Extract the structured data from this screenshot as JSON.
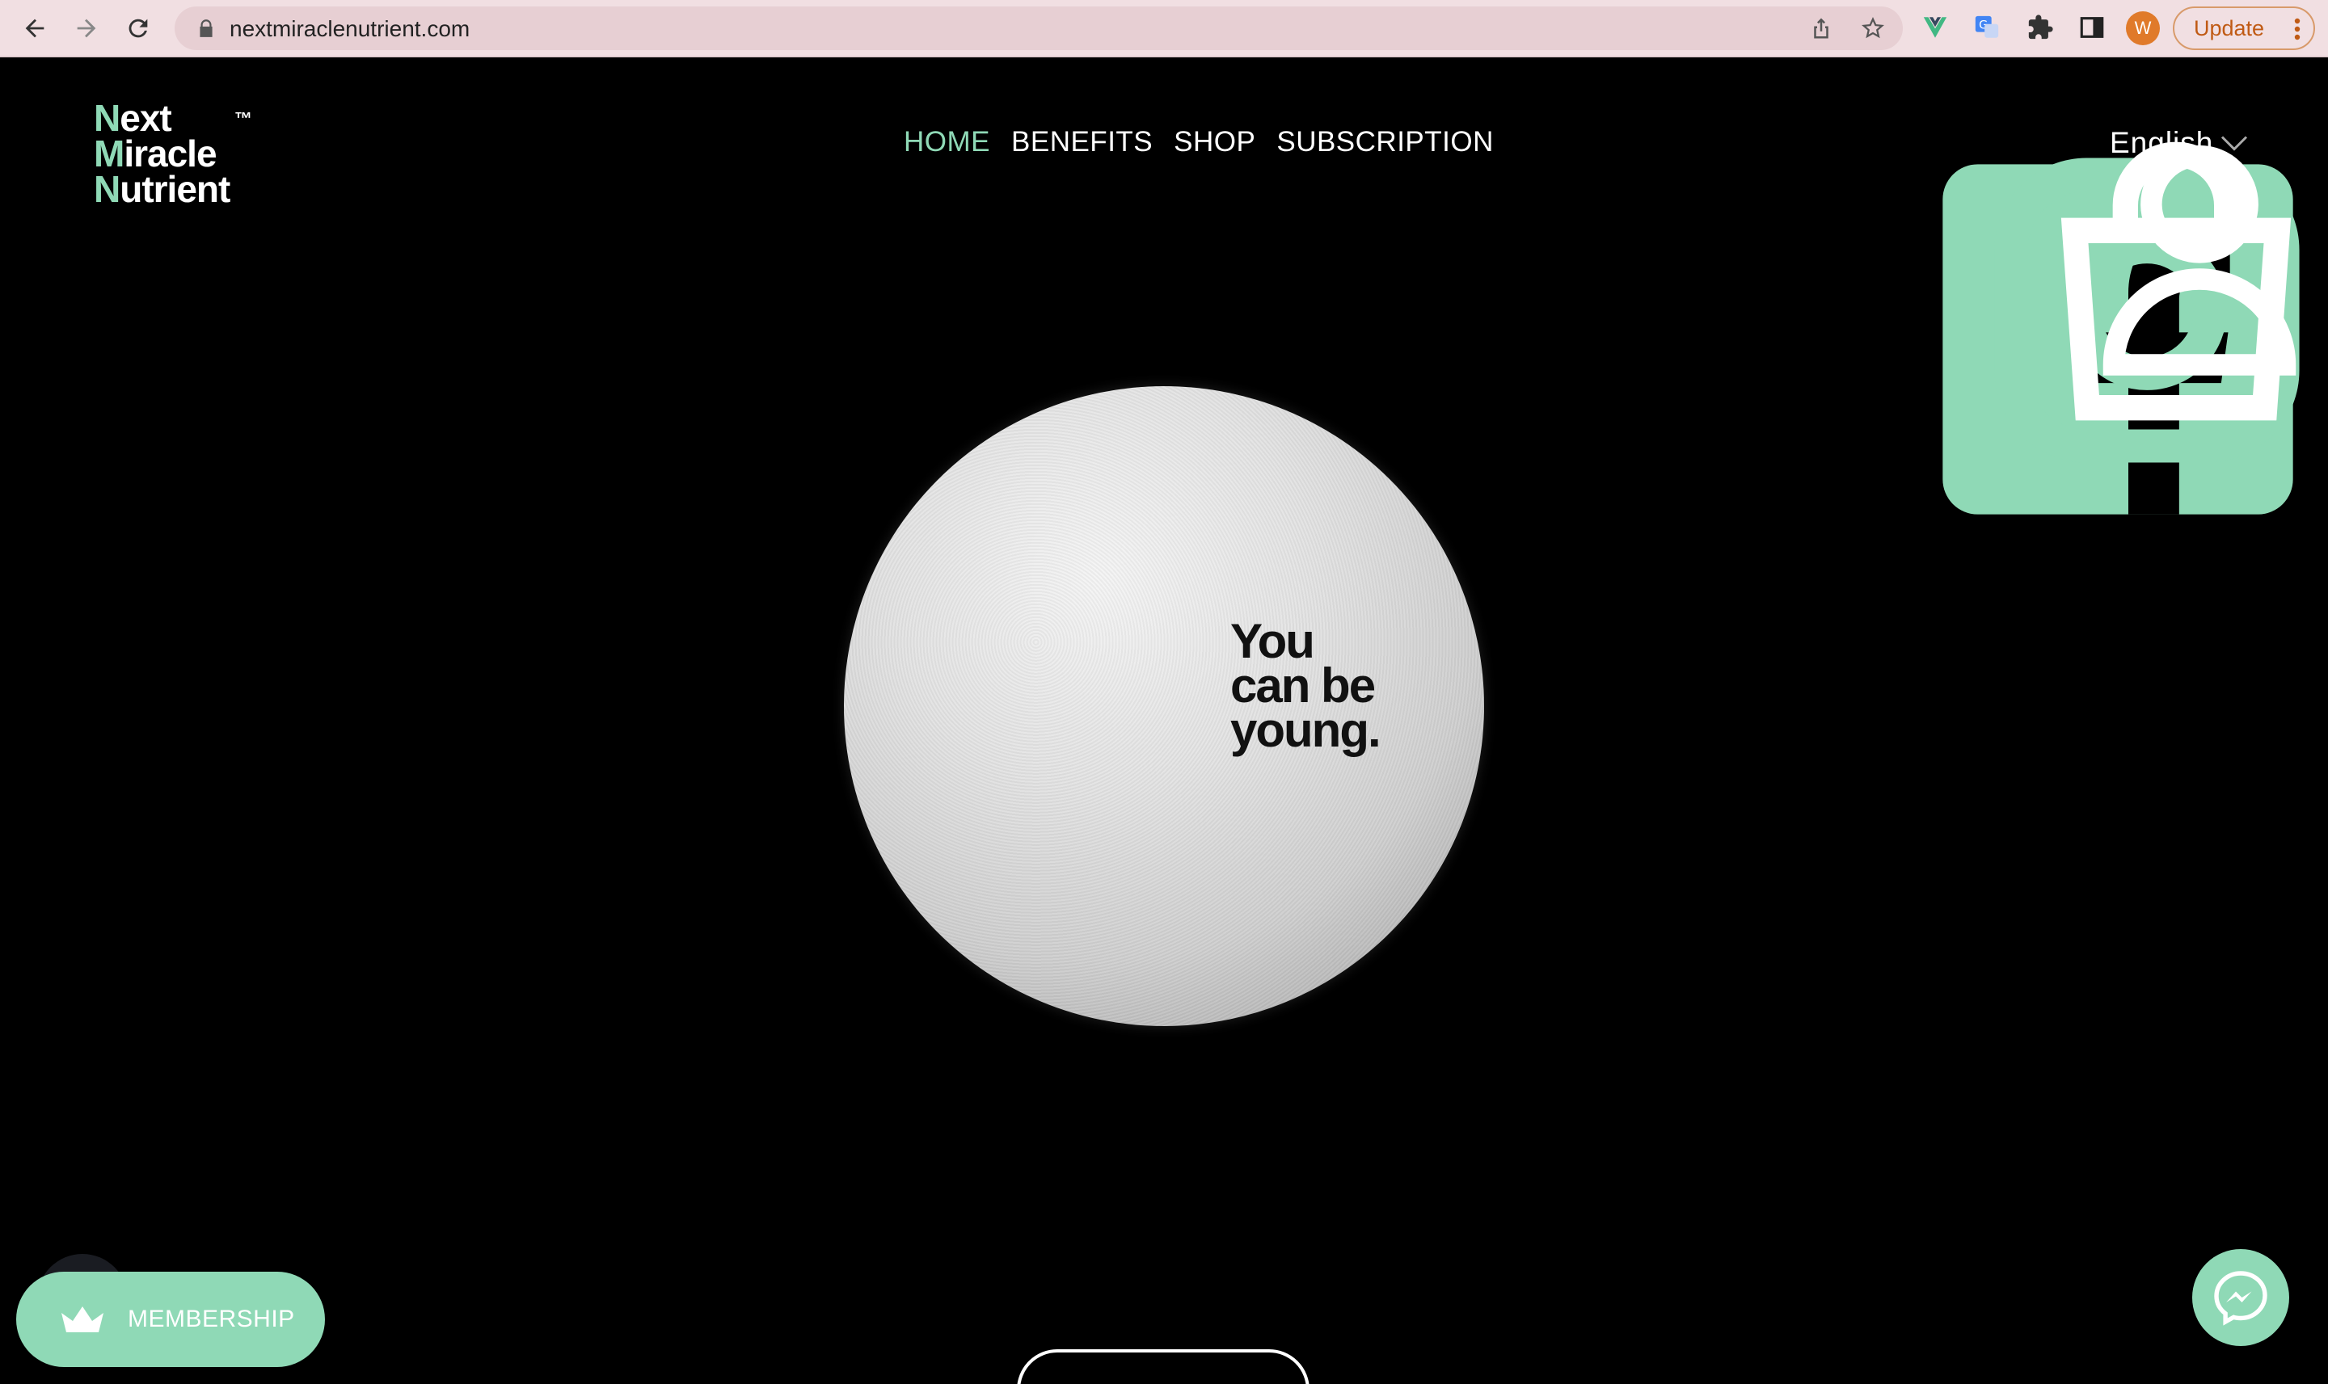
{
  "browser": {
    "url": "nextmiraclenutrient.com",
    "profile_initial": "W",
    "update_label": "Update",
    "icons": [
      "back-icon",
      "forward-icon",
      "reload-icon",
      "lock-icon",
      "share-icon",
      "star-icon",
      "vue-devtools-icon",
      "google-translate-icon",
      "extensions-icon",
      "side-panel-icon",
      "menu-dots-icon"
    ]
  },
  "site": {
    "logo": {
      "line1_cap": "N",
      "line1_rest": "ext",
      "line2_cap": "M",
      "line2_rest": "iracle",
      "line3_cap": "N",
      "line3_rest": "utrient",
      "tm": "™"
    },
    "nav": {
      "home": "HOME",
      "benefits": "BENEFITS",
      "shop": "SHOP",
      "subscription": "SUBSCRIPTION",
      "active": "HOME"
    },
    "language": "English",
    "accent_color": "#8fd9b6",
    "header_icons": [
      "facebook-icon",
      "instagram-icon",
      "cart-icon",
      "account-icon",
      "chevron-down-icon"
    ]
  },
  "hero": {
    "line1": "You",
    "line2": "can be",
    "line3": "young."
  },
  "widgets": {
    "membership_label": "MEMBERSHIP",
    "membership_icon": "crown-icon",
    "messenger_icon": "messenger-icon"
  }
}
